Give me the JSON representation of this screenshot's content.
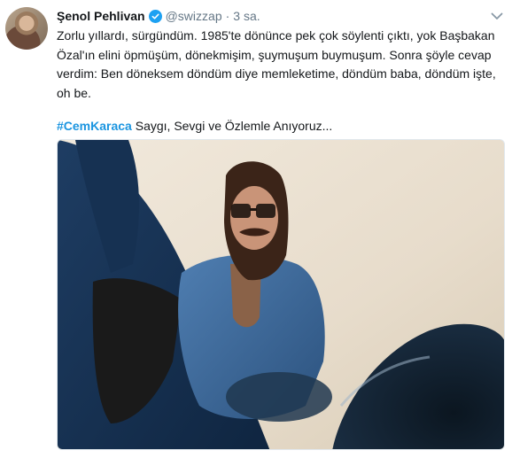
{
  "tweet": {
    "author_name": "Şenol Pehlivan",
    "handle": "@swizzap",
    "separator": "·",
    "time": "3 sa.",
    "body_lines": [
      "Zorlu yıllardı, sürgündüm. 1985'te dönünce pek çok söylenti çıktı, yok Başbakan",
      "Özal'ın elini öpmüşüm, dönekmişim, şuymuşum buymuşum. Sonra şöyle cevap",
      "verdim: Ben döneksem döndüm diye memleketime, döndüm baba, döndüm işte,",
      "oh be."
    ],
    "hashtag": "#CemKaraca",
    "hashtag_suffix": " Saygı, Sevgi ve Özlemle Anıyoruz..."
  },
  "icons": {
    "verified": "verified-badge-icon",
    "caret": "chevron-down-icon"
  },
  "colors": {
    "verified_blue": "#1da1f2",
    "hashtag_blue": "#1b95e0",
    "meta_gray": "#657786"
  }
}
